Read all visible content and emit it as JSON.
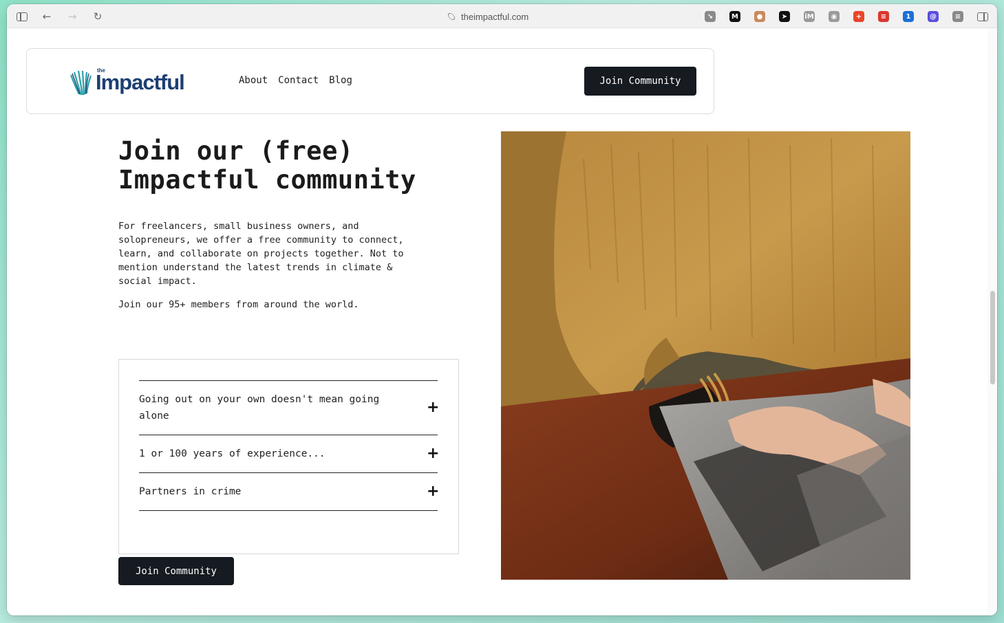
{
  "browser": {
    "url": "theimpactful.com",
    "extensions": [
      {
        "name": "arrow-extension-icon",
        "color": "#8a8a8a",
        "glyph": "↘"
      },
      {
        "name": "medium-extension-icon",
        "color": "#111111",
        "glyph": "M"
      },
      {
        "name": "avatar-extension-icon",
        "color": "#c98a5a",
        "glyph": "●"
      },
      {
        "name": "send-extension-icon",
        "color": "#111111",
        "glyph": "➤"
      },
      {
        "name": "im-extension-icon",
        "color": "#9a9a9a",
        "glyph": "iM"
      },
      {
        "name": "camera-extension-icon",
        "color": "#9a9a9a",
        "glyph": "◉"
      },
      {
        "name": "plus-extension-icon",
        "color": "#e8452c",
        "glyph": "+"
      },
      {
        "name": "todoist-extension-icon",
        "color": "#d9372e",
        "glyph": "≡"
      },
      {
        "name": "onepassword-extension-icon",
        "color": "#1a6fd8",
        "glyph": "1"
      },
      {
        "name": "swirl-extension-icon",
        "color": "#5a4ee0",
        "glyph": "@"
      },
      {
        "name": "toggle-extension-icon",
        "color": "#8a8a8a",
        "glyph": "≡"
      }
    ]
  },
  "nav": {
    "logo_small": "the",
    "logo_text": "Impactful",
    "links": [
      "About",
      "Contact",
      "Blog"
    ],
    "cta": "Join Community"
  },
  "hero": {
    "title_line1": "Join our (free)",
    "title_line2": "Impactful community",
    "description": "For freelancers, small business owners, and solopreneurs, we offer a free community to connect, learn, and collaborate on projects together. Not to mention understand the latest trends in climate & social impact.",
    "members": "Join our 95+ members from around the world.",
    "accordion": [
      "Going out on your own doesn't mean going alone",
      "1 or 100 years of experience...",
      "Partners in crime"
    ],
    "cta": "Join Community"
  },
  "colors": {
    "brand_navy": "#1d3f73",
    "brand_teal": "#2aa0a8",
    "button_dark": "#161a21"
  }
}
